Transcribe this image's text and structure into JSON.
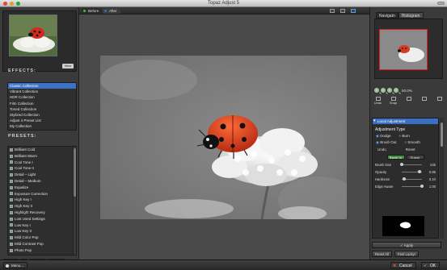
{
  "window": {
    "title": "Topaz Adjust 5"
  },
  "thumbnail": {
    "view_label": "View"
  },
  "effects": {
    "heading": "EFFECTS:",
    "items": [
      "Classic Collection",
      "Vibrant Collection",
      "HDR Collection",
      "Film Collection",
      "Toned Collection",
      "Stylized Collection",
      "Adjust 4 Preset List",
      "My Collection"
    ],
    "selected_index": 0
  },
  "presets": {
    "heading": "PRESETS:",
    "items": [
      "Brilliant Cold",
      "Brilliant Warm",
      "Cool Tone I",
      "Cool Tone II",
      "Detail – Light",
      "Detail – Medium",
      "Equalize",
      "Exposure Correction",
      "High Key I",
      "High Key II",
      "Highlight Recovery",
      "Lost Used Settings",
      "Low Key I",
      "Low Key II",
      "Mild Color Pop",
      "Mild Contrast Pop",
      "Photo Pop",
      "Shadow Recovery"
    ]
  },
  "left_footer": {
    "save": "Save",
    "import": "Import",
    "export": "Export"
  },
  "preview_tabs": {
    "before": "Before",
    "after": "After"
  },
  "colors": {
    "before_dot": "#3fbf3f",
    "after_dot": "#3b6fbf",
    "selection": "#3c72c6",
    "nav_frame": "#e02020"
  },
  "right": {
    "tabs": [
      "Navigatn",
      "Histogram"
    ],
    "zoom": "50.0%",
    "tools": [
      "Undo",
      "Snap",
      "",
      ""
    ],
    "adjustment": {
      "header": "Local Adjustment",
      "title": "Adjustment Type",
      "options": [
        {
          "label": "Dodge",
          "on": true
        },
        {
          "label": "Burn",
          "on": false
        },
        {
          "label": "Brush Out",
          "on": true
        },
        {
          "label": "Smooth",
          "on": false
        }
      ],
      "undo": "Undo",
      "reset": "Reset",
      "brush_in": "Brush In",
      "eraser": "Eraser",
      "params": [
        {
          "label": "Brush Size",
          "value": "245",
          "level": 0.0
        },
        {
          "label": "Opacity",
          "value": "0.86",
          "level": 0.86
        },
        {
          "label": "Hardness",
          "value": "0.10",
          "level": 0.1
        },
        {
          "label": "Edge Aware",
          "value": "1.00",
          "level": 1.0
        }
      ]
    },
    "apply": "Apply",
    "reset_all": "Reset All",
    "feel_lucky": "Feel Lucky!"
  },
  "bottom": {
    "menu": "Menu...",
    "cancel": "Cancel",
    "ok": "OK"
  }
}
